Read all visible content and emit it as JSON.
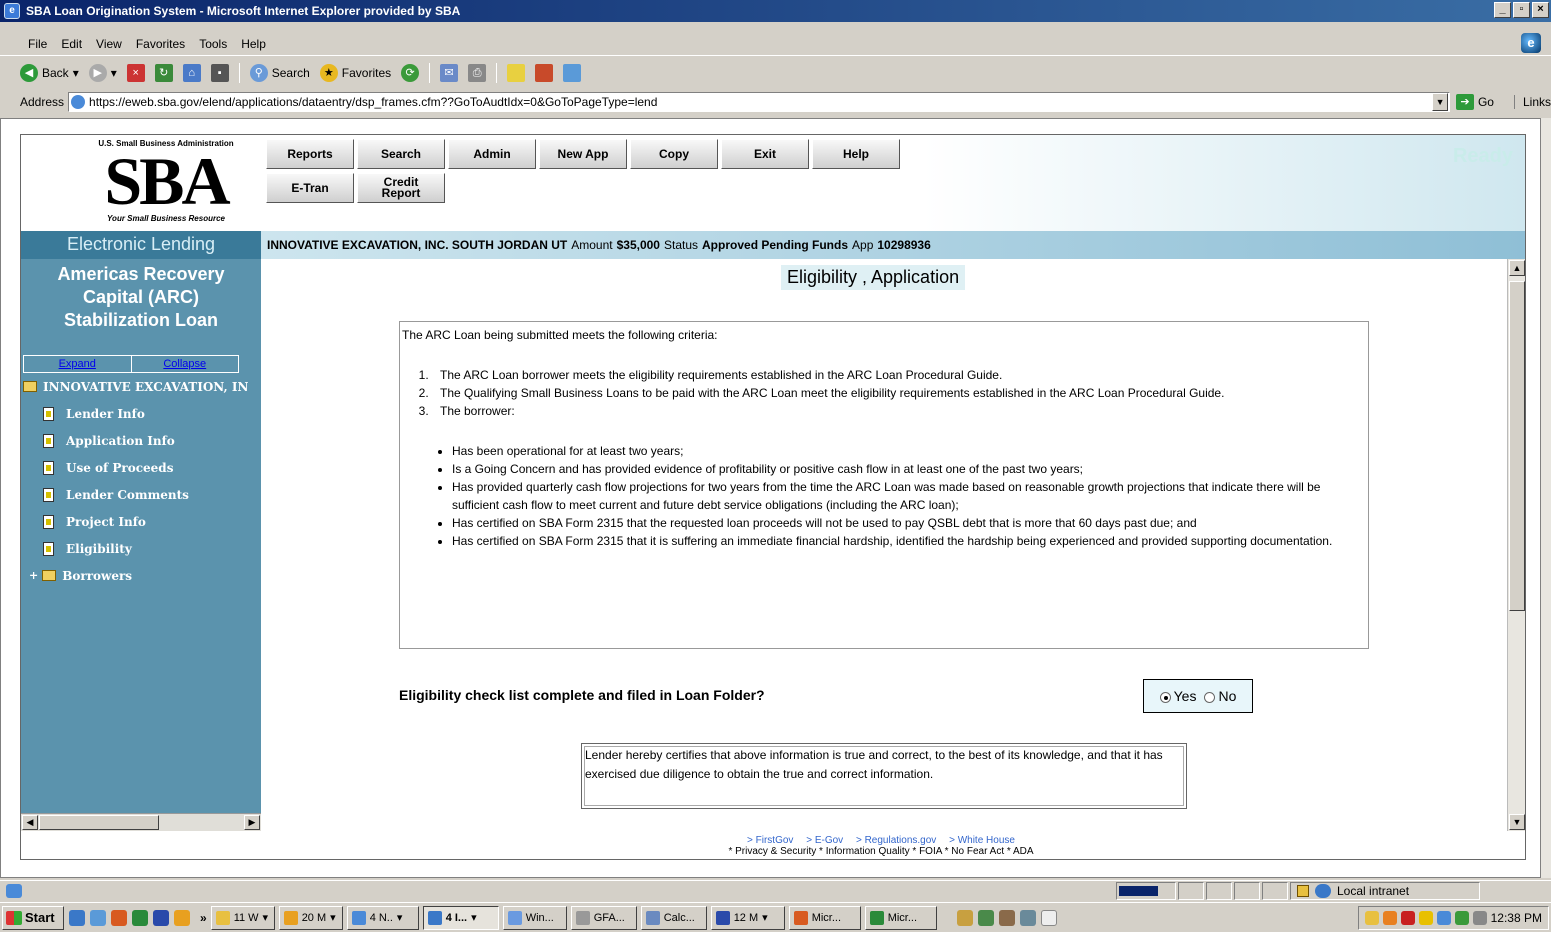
{
  "window": {
    "title": "SBA Loan Origination System - Microsoft Internet Explorer provided by SBA"
  },
  "menu": [
    "File",
    "Edit",
    "View",
    "Favorites",
    "Tools",
    "Help"
  ],
  "toolbar": {
    "back": "Back",
    "search": "Search",
    "favorites": "Favorites"
  },
  "address": {
    "label": "Address",
    "url": "https://eweb.sba.gov/elend/applications/dataentry/dsp_frames.cfm??GoToAudtIdx=0&GoToPageType=lend",
    "go": "Go",
    "links": "Links"
  },
  "header": {
    "agency": "U.S. Small Business Administration",
    "logo": "SBA",
    "tagline": "Your Small Business Resource",
    "ready": "Ready",
    "nav_row1": [
      "Reports",
      "Search",
      "Admin",
      "New App",
      "Copy",
      "Exit",
      "Help"
    ],
    "etran": "E-Tran",
    "credit_report_1": "Credit",
    "credit_report_2": "Report"
  },
  "section_label": "Electronic Lending",
  "status": {
    "business": "INNOVATIVE EXCAVATION, INC. SOUTH JORDAN UT",
    "amount_label": "Amount",
    "amount": "$35,000",
    "status_label": "Status",
    "status": "Approved Pending Funds",
    "app_label": "App",
    "app": "10298936"
  },
  "sidebar": {
    "title_1": "Americas Recovery",
    "title_2": "Capital (ARC)",
    "title_3": "Stabilization Loan",
    "expand": "Expand",
    "collapse": "Collapse",
    "root": "INNOVATIVE EXCAVATION, IN",
    "items": [
      "Lender Info",
      "Application Info",
      "Use of Proceeds",
      "Lender Comments",
      "Project Info",
      "Eligibility"
    ],
    "borrowers": "Borrowers"
  },
  "main": {
    "title": "Eligibility , Application",
    "intro": "The ARC Loan being submitted meets the following criteria:",
    "criteria": [
      "The ARC Loan borrower meets the eligibility requirements established in the ARC Loan Procedural Guide.",
      "The Qualifying Small Business Loans to be paid with the ARC Loan meet the eligibility requirements established in the ARC Loan Procedural Guide.",
      "The borrower:"
    ],
    "borrower_points": [
      "Has been operational for at least two years;",
      "Is a Going Concern and has provided evidence of profitability or positive cash flow in at least one of the past two years;",
      "Has provided quarterly cash flow projections for two years from the time the ARC Loan was made based on reasonable growth projections that indicate there will be sufficient cash flow to meet current and future debt service obligations (including the ARC loan);",
      "Has certified on SBA Form 2315 that the requested loan proceeds will not be used to pay QSBL debt that is more that 60 days past due; and",
      " Has certified on SBA Form 2315 that it is suffering an immediate financial hardship, identified the hardship being experienced and provided supporting documentation."
    ],
    "question": "Eligibility check list complete and filed in Loan Folder?",
    "yes": "Yes",
    "no": "No",
    "certification": "Lender hereby certifies that above information is true and correct, to the best of its knowledge, and that it has exercised due diligence to obtain the true and correct information."
  },
  "footer": {
    "links": [
      "> FirstGov",
      "> E-Gov",
      "> Regulations.gov",
      "> White House"
    ],
    "policies": "* Privacy & Security  * Information Quality  * FOIA  * No Fear Act  * ADA"
  },
  "ie_status": {
    "zone": "Local intranet",
    "progress": 0.75
  },
  "taskbar": {
    "start": "Start",
    "more": "»",
    "tasks": [
      {
        "label": "11 W",
        "color": "#e8c040"
      },
      {
        "label": "20 M",
        "color": "#e8a020"
      },
      {
        "label": "4 N..",
        "color": "#4a8ad8"
      },
      {
        "label": "4 I...",
        "color": "#3a78c8",
        "active": true
      },
      {
        "label": "Win...",
        "color": "#6a9ae0"
      },
      {
        "label": "GFA...",
        "color": "#999999"
      },
      {
        "label": "Calc...",
        "color": "#6a8ac0"
      },
      {
        "label": "12 M",
        "color": "#2a4aaa"
      },
      {
        "label": "Micr...",
        "color": "#d85a20"
      },
      {
        "label": "Micr...",
        "color": "#2a8a3a"
      }
    ],
    "time": "12:38 PM"
  },
  "colors": {
    "sidebar_bg": "#5b93ad",
    "elec_lending_bg": "#3a7a99",
    "link_blue": "#3366cc"
  }
}
